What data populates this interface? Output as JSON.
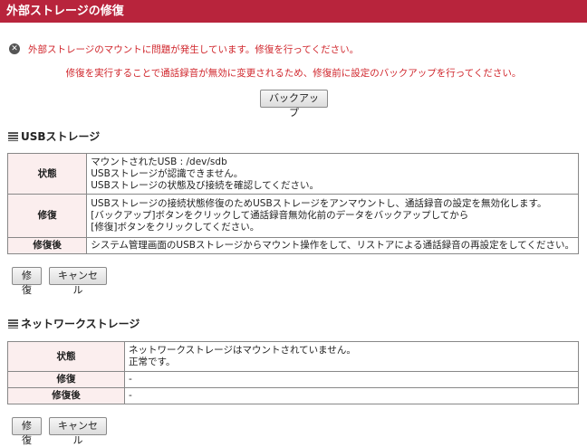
{
  "header": {
    "title": "外部ストレージの修復"
  },
  "alert": {
    "icon": "error-circle-icon",
    "message": "外部ストレージのマウントに問題が発生しています。修復を行ってください。",
    "note": "修復を実行することで通話録音が無効に変更されるため、修復前に設定のバックアップを行ってください。",
    "color": "#d0262c"
  },
  "backup_button": "バックアップ",
  "usb": {
    "title": "USBストレージ",
    "rows": [
      {
        "label": "状態",
        "lines": [
          "マウントされたUSB : /dev/sdb",
          "USBストレージが認識できません。",
          "USBストレージの状態及び接続を確認してください。"
        ]
      },
      {
        "label": "修復",
        "lines": [
          "USBストレージの接続状態修復のためUSBストレージをアンマウントし、通話録音の設定を無効化します。",
          "[バックアップ]ボタンをクリックして通話録音無効化前のデータをバックアップしてから",
          "[修復]ボタンをクリックしてください。"
        ]
      },
      {
        "label": "修復後",
        "lines": [
          "システム管理画面のUSBストレージからマウント操作をして、リストアによる通話録音の再設定をしてください。"
        ]
      }
    ],
    "repair_button": "修復",
    "cancel_button": "キャンセル"
  },
  "network": {
    "title": "ネットワークストレージ",
    "rows": [
      {
        "label": "状態",
        "lines": [
          "ネットワークストレージはマウントされていません。",
          "正常です。"
        ]
      },
      {
        "label": "修復",
        "lines": [
          "-"
        ]
      },
      {
        "label": "修復後",
        "lines": [
          "-"
        ]
      }
    ],
    "repair_button": "修復",
    "cancel_button": "キャンセル"
  },
  "colors": {
    "header_bg": "#b8243c",
    "label_bg": "#fbeeee"
  }
}
